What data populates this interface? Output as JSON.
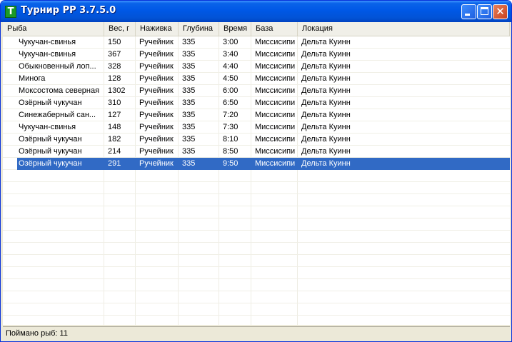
{
  "window": {
    "title": "Турнир РР 3.7.5.0",
    "icon_letter": "T"
  },
  "columns": [
    "Рыба",
    "Вес, г",
    "Наживка",
    "Глубина",
    "Время",
    "База",
    "Локация"
  ],
  "rows": [
    [
      "Чукучан-свинья",
      "150",
      "Ручейник",
      "335",
      "3:00",
      "Миссисипи",
      "Дельта Куинн"
    ],
    [
      "Чукучан-свинья",
      "367",
      "Ручейник",
      "335",
      "3:40",
      "Миссисипи",
      "Дельта Куинн"
    ],
    [
      "Обыкновенный лоп...",
      "328",
      "Ручейник",
      "335",
      "4:40",
      "Миссисипи",
      "Дельта Куинн"
    ],
    [
      "Минога",
      "128",
      "Ручейник",
      "335",
      "4:50",
      "Миссисипи",
      "Дельта Куинн"
    ],
    [
      "Моксостома северная",
      "1302",
      "Ручейник",
      "335",
      "6:00",
      "Миссисипи",
      "Дельта Куинн"
    ],
    [
      "Озёрный чукучан",
      "310",
      "Ручейник",
      "335",
      "6:50",
      "Миссисипи",
      "Дельта Куинн"
    ],
    [
      "Синежаберный сан...",
      "127",
      "Ручейник",
      "335",
      "7:20",
      "Миссисипи",
      "Дельта Куинн"
    ],
    [
      "Чукучан-свинья",
      "148",
      "Ручейник",
      "335",
      "7:30",
      "Миссисипи",
      "Дельта Куинн"
    ],
    [
      "Озёрный чукучан",
      "182",
      "Ручейник",
      "335",
      "8:10",
      "Миссисипи",
      "Дельта Куинн"
    ],
    [
      "Озёрный чукучан",
      "214",
      "Ручейник",
      "335",
      "8:50",
      "Миссисипи",
      "Дельта Куинн"
    ],
    [
      "Озёрный чукучан",
      "291",
      "Ручейник",
      "335",
      "9:50",
      "Миссисипи",
      "Дельта Куинн"
    ]
  ],
  "selected_row": 10,
  "status": {
    "text": "Поймано рыб: 11"
  },
  "colors": {
    "titlebar": "#0058E6",
    "selection": "#316AC5",
    "face": "#ECE9D8"
  }
}
